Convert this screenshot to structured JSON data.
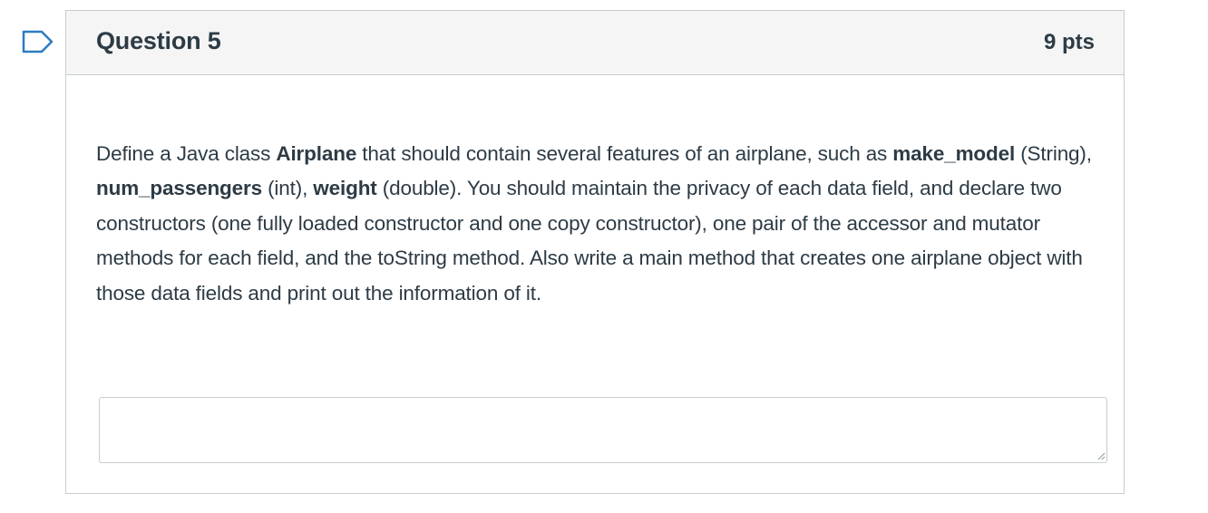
{
  "question": {
    "title": "Question 5",
    "points": "9 pts",
    "text_parts": [
      "Define a Java class ",
      "Airplane",
      " that should contain several features of an airplane, such as ",
      "make_model",
      " (String), ",
      "num_passengers",
      " (int), ",
      "weight",
      " (double). You should maintain the privacy of each data field, and declare two constructors (one fully loaded constructor and one copy constructor), one pair of the accessor and mutator methods for each field, and the toString method. Also write a main method that creates one airplane object with those data fields and print out the information of it."
    ],
    "answer_value": ""
  },
  "icons": {
    "flag": "flag-icon",
    "resize": "resize-grip-icon"
  },
  "colors": {
    "text": "#2d3b45",
    "border": "#c7cdd1",
    "header_bg": "#f5f5f5",
    "flag": "#2d7bc2"
  }
}
